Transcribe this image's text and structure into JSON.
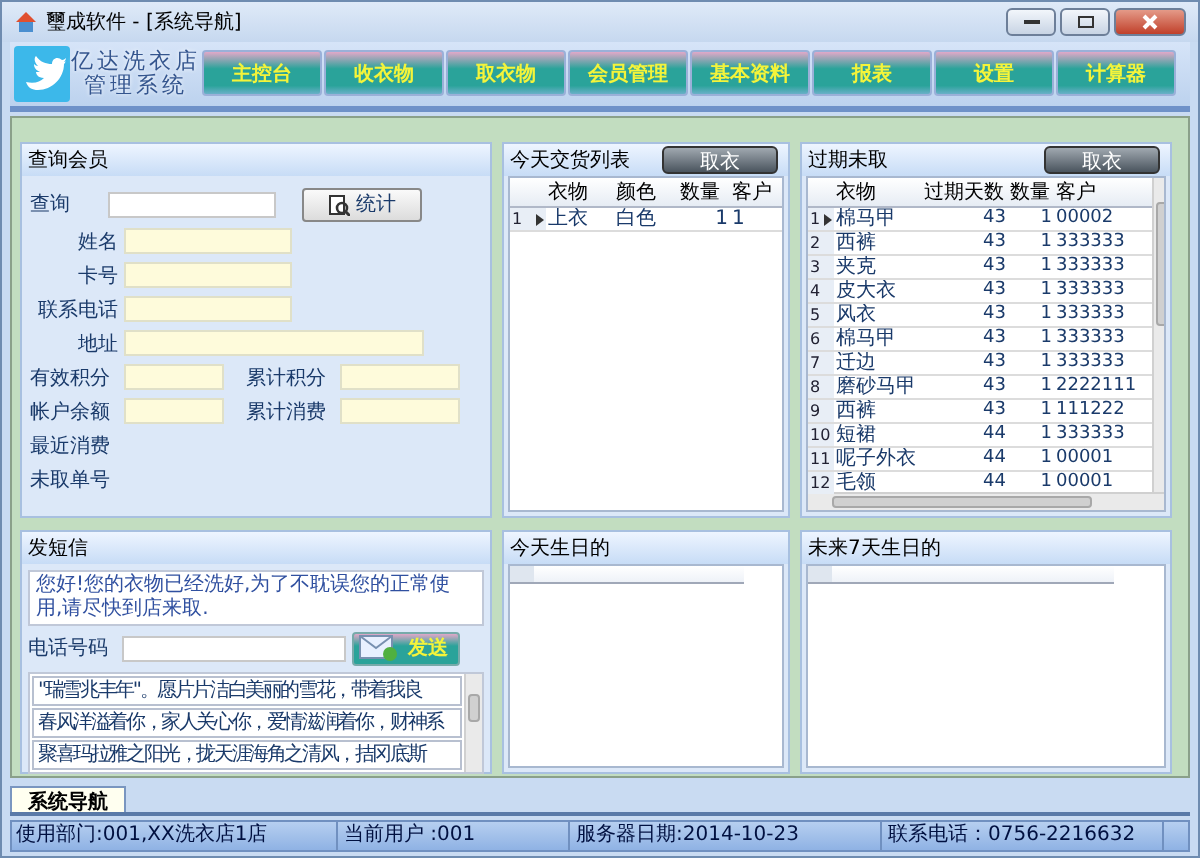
{
  "window": {
    "title": "璽成软件 - [系统导航]"
  },
  "brand": {
    "lines": [
      "亿达洗衣店",
      "管理系统"
    ]
  },
  "nav": [
    "主控台",
    "收衣物",
    "取衣物",
    "会员管理",
    "基本资料",
    "报表",
    "设置",
    "计算器"
  ],
  "member": {
    "title": "查询会员",
    "search_label": "查询",
    "stat_button": "统计",
    "fields": [
      {
        "label": "姓名",
        "wide": false
      },
      {
        "label": "卡号",
        "wide": false
      },
      {
        "label": "联系电话",
        "wide": false
      },
      {
        "label": "地址",
        "wide": true
      }
    ],
    "pairs": [
      [
        "有效积分",
        "累计积分"
      ],
      [
        "帐户余额",
        "累计消费"
      ]
    ],
    "notes": [
      "最近消费",
      "未取单号"
    ]
  },
  "today": {
    "title": "今天交货列表",
    "button": "取衣",
    "columns": [
      "衣物",
      "颜色",
      "数量",
      "客户"
    ],
    "rows": [
      {
        "num": "1",
        "selected": true,
        "cells": [
          "上衣",
          "白色",
          "1",
          "1"
        ]
      }
    ]
  },
  "overdue": {
    "title": "过期未取",
    "button": "取衣",
    "columns": [
      "衣物",
      "过期天数",
      "数量",
      "客户"
    ],
    "rows": [
      {
        "num": "1",
        "selected": true,
        "cells": [
          "棉马甲",
          "43",
          "1",
          "00002"
        ]
      },
      {
        "num": "2",
        "selected": false,
        "cells": [
          "西裤",
          "43",
          "1",
          "333333"
        ]
      },
      {
        "num": "3",
        "selected": false,
        "cells": [
          "夹克",
          "43",
          "1",
          "333333"
        ]
      },
      {
        "num": "4",
        "selected": false,
        "cells": [
          "皮大衣",
          "43",
          "1",
          "333333"
        ]
      },
      {
        "num": "5",
        "selected": false,
        "cells": [
          "风衣",
          "43",
          "1",
          "333333"
        ]
      },
      {
        "num": "6",
        "selected": false,
        "cells": [
          "棉马甲",
          "43",
          "1",
          "333333"
        ]
      },
      {
        "num": "7",
        "selected": false,
        "cells": [
          "迁边",
          "43",
          "1",
          "333333"
        ]
      },
      {
        "num": "8",
        "selected": false,
        "cells": [
          "磨砂马甲",
          "43",
          "1",
          "2222111"
        ]
      },
      {
        "num": "9",
        "selected": false,
        "cells": [
          "西裤",
          "43",
          "1",
          "111222"
        ]
      },
      {
        "num": "10",
        "selected": false,
        "cells": [
          "短裙",
          "44",
          "1",
          "333333"
        ]
      },
      {
        "num": "11",
        "selected": false,
        "cells": [
          "呢子外衣",
          "44",
          "1",
          "00001"
        ]
      },
      {
        "num": "12",
        "selected": false,
        "cells": [
          "毛领",
          "44",
          "1",
          "00001"
        ]
      }
    ]
  },
  "sms": {
    "title": "发短信",
    "message": "您好!您的衣物已经洗好,为了不耽误您的正常使用,请尽快到店来取.",
    "phone_label": "电话号码",
    "send_button": "发送",
    "templates": [
      "\"瑞雪兆丰年\"。愿片片洁白美丽的雪花，带着我良",
      "春风洋溢着你，家人关心你，爱情滋润着你，财神系",
      "聚喜玛拉雅之阳光，拢天涯海角之清风，拮冈底斯"
    ]
  },
  "birthday_today": {
    "title": "今天生日的"
  },
  "birthday_week": {
    "title": "未来7天生日的"
  },
  "bottom_tabs": [
    {
      "label": "系统导航",
      "selected": true
    }
  ],
  "status_bar": [
    "使用部门:001,XX洗衣店1店",
    "当前用户 :001",
    "服务器日期:2014-10-23",
    "联系电话：0756-2216632"
  ]
}
